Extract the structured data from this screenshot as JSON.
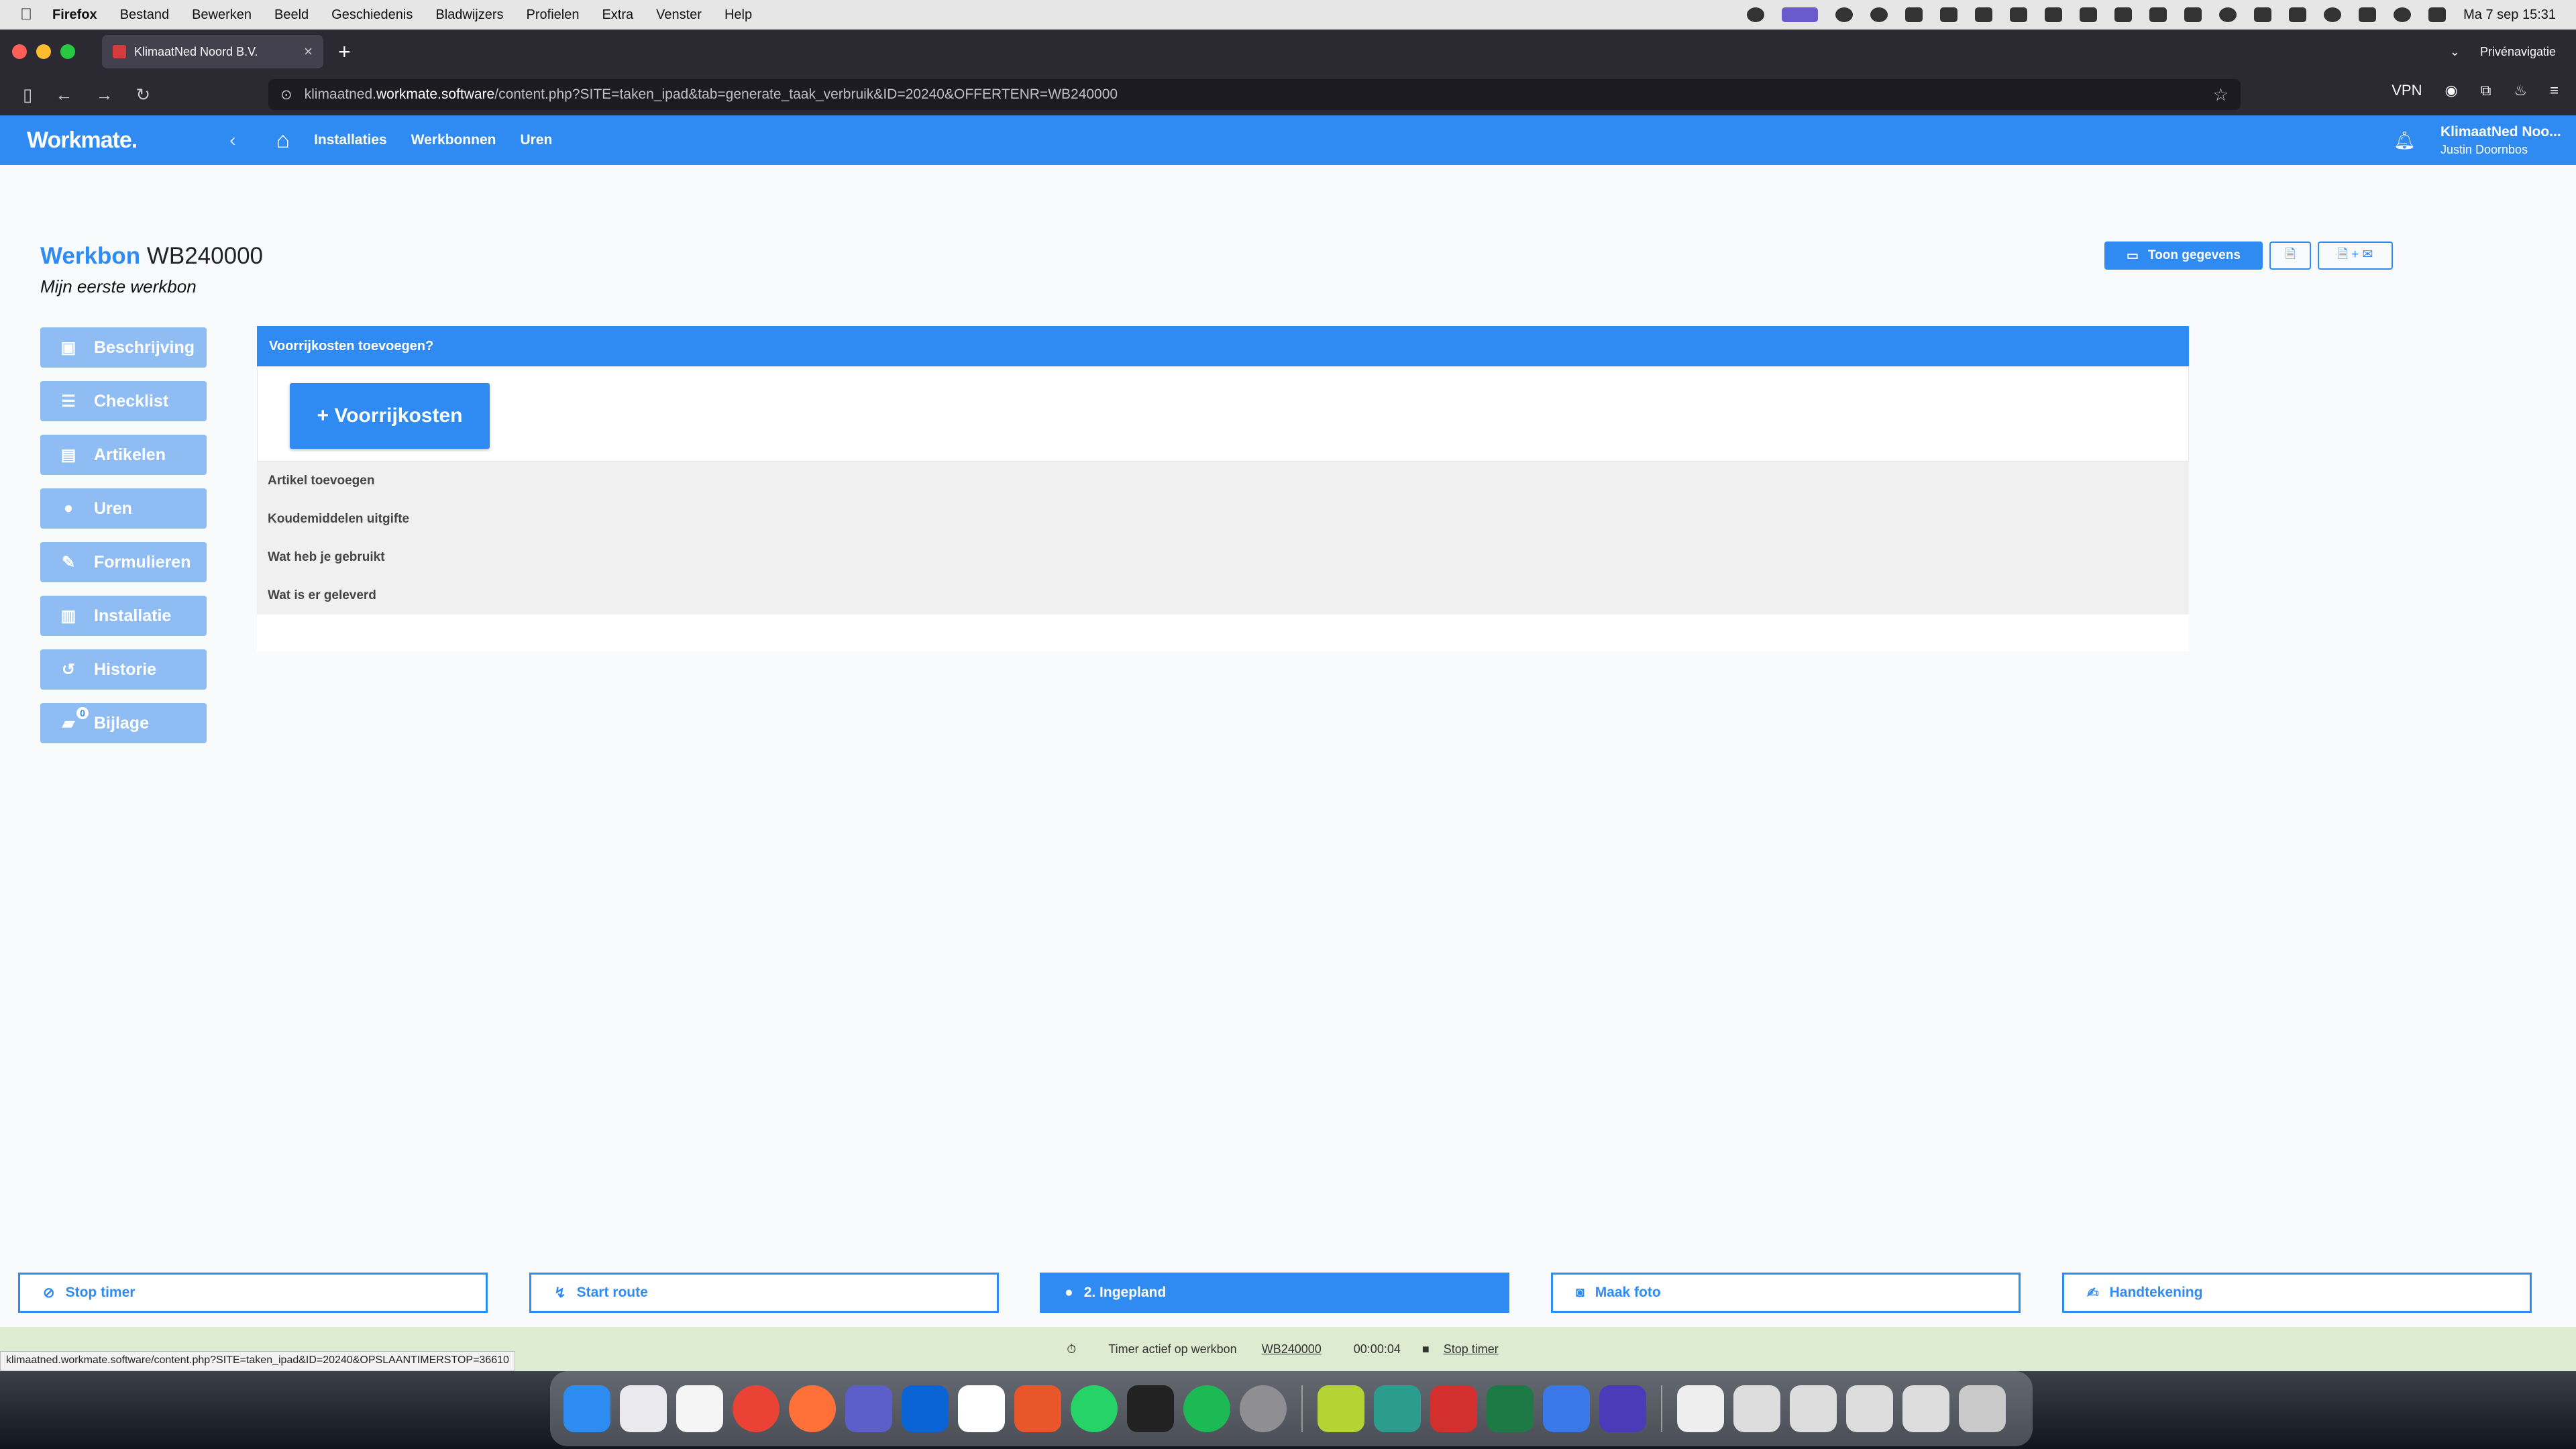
{
  "menubar": {
    "app": "Firefox",
    "items": [
      "Bestand",
      "Bewerken",
      "Beeld",
      "Geschiedenis",
      "Bladwijzers",
      "Profielen",
      "Extra",
      "Venster",
      "Help"
    ],
    "datetime": "Ma 7 sep  15:31"
  },
  "browser": {
    "tab_title": "KlimaatNed Noord B.V.",
    "url_prefix": "klimaatned.",
    "url_domain": "workmate.software",
    "url_path": "/content.php?SITE=taken_ipad&tab=generate_taak_verbruik&ID=20240&OFFERTENR=WB240000",
    "vpn": "VPN",
    "private": "Privénavigatie"
  },
  "app": {
    "logo": "Workmate.",
    "nav": [
      "Installaties",
      "Werkbonnen",
      "Uren"
    ],
    "user_company": "KlimaatNed Noo...",
    "user_name": "Justin Doornbos"
  },
  "page": {
    "title_prefix": "Werkbon",
    "title_number": "WB240000",
    "subtitle": "Mijn eerste werkbon",
    "toon_gegevens": "Toon gegevens"
  },
  "sidebar": [
    {
      "label": "Beschrijving",
      "icon": "comment-icon"
    },
    {
      "label": "Checklist",
      "icon": "list-icon"
    },
    {
      "label": "Artikelen",
      "icon": "box-icon"
    },
    {
      "label": "Uren",
      "icon": "user-icon"
    },
    {
      "label": "Formulieren",
      "icon": "form-icon"
    },
    {
      "label": "Installatie",
      "icon": "chart-icon"
    },
    {
      "label": "Historie",
      "icon": "history-icon"
    },
    {
      "label": "Bijlage",
      "icon": "folder-icon",
      "badge": "0"
    }
  ],
  "main": {
    "header": "Voorrijkosten toevoegen?",
    "button": "+ Voorrijkosten",
    "rows": [
      "Artikel toevoegen",
      "Koudemiddelen uitgifte",
      "Wat heb je gebruikt",
      "Wat is er geleverd"
    ]
  },
  "bottom": [
    {
      "label": "Stop timer",
      "icon": "timer-off-icon"
    },
    {
      "label": "Start route",
      "icon": "route-icon"
    },
    {
      "label": "2. Ingepland",
      "icon": "person-icon"
    },
    {
      "label": "Maak foto",
      "icon": "camera-icon"
    },
    {
      "label": "Handtekening",
      "icon": "signature-icon"
    }
  ],
  "timer": {
    "text": "Timer actief op werkbon",
    "werkbon": "WB240000",
    "time": "00:00:04",
    "stop": "Stop timer"
  },
  "statusbar": "klimaatned.workmate.software/content.php?SITE=taken_ipad&ID=20240&OPSLAANTIMERSTOP=36610"
}
